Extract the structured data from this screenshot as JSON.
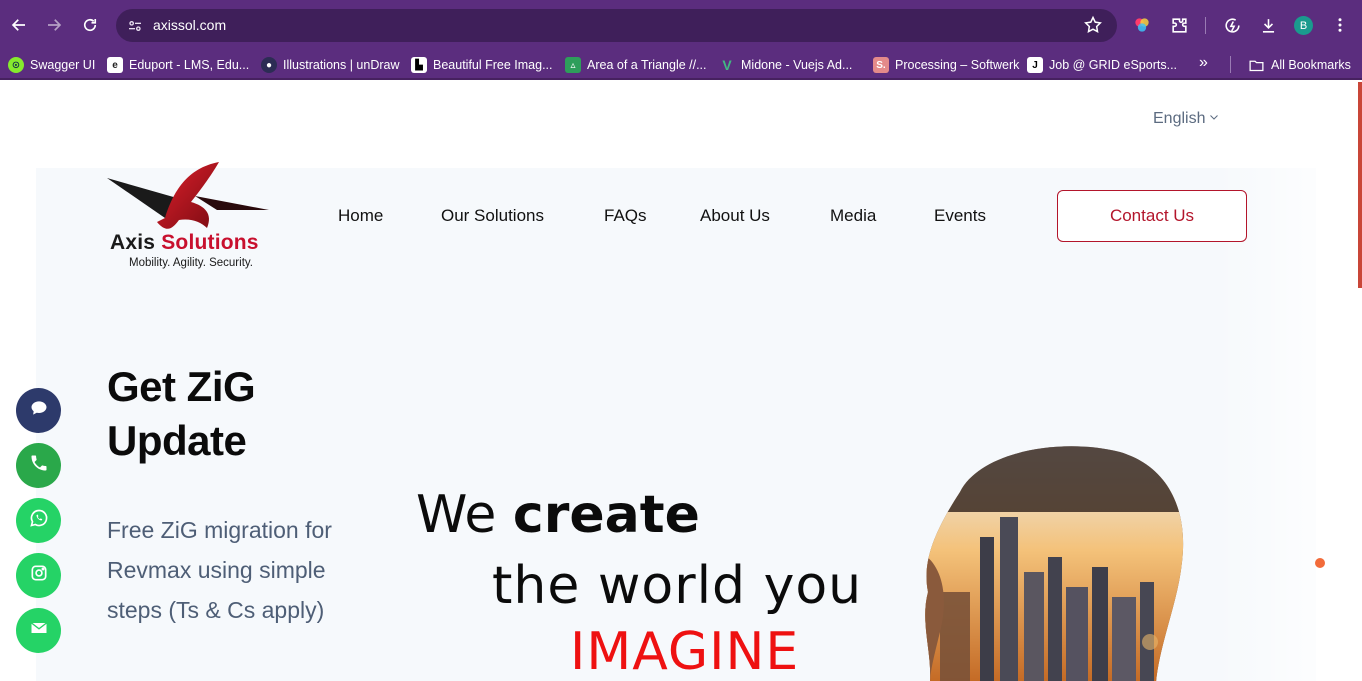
{
  "browser": {
    "url": "axissol.com",
    "profile_initial": "B",
    "bookmarks": [
      {
        "label": "Swagger UI",
        "icon": "swagger-icon",
        "color": "#85ea2d"
      },
      {
        "label": "Eduport - LMS, Edu...",
        "icon": "eduport-icon",
        "color": "#ffffff"
      },
      {
        "label": "Illustrations | unDraw",
        "icon": "undraw-icon",
        "color": "#6c63ff"
      },
      {
        "label": "Beautiful Free Imag...",
        "icon": "unsplash-icon",
        "color": "#000000"
      },
      {
        "label": "Area of a Triangle //...",
        "icon": "triangle-icon",
        "color": "#2e9e5b"
      },
      {
        "label": "Midone - Vuejs Ad...",
        "icon": "vue-icon",
        "color": "#41b883"
      },
      {
        "label": "Processing – Softwerk",
        "icon": "processing-icon",
        "color": "#e48a8a"
      },
      {
        "label": "Job @ GRID eSports...",
        "icon": "grid-icon",
        "color": "#ffffff"
      }
    ],
    "all_bookmarks_label": "All Bookmarks"
  },
  "site": {
    "language": "English",
    "logo": {
      "word_main": "Axis",
      "word_accent": "Solutions",
      "tagline": "Mobility. Agility. Security."
    },
    "nav": [
      "Home",
      "Our Solutions",
      "FAQs",
      "About Us",
      "Media",
      "Events"
    ],
    "contact_label": "Contact Us",
    "hero": {
      "headline_line1": "Get ZiG",
      "headline_line2": "Update",
      "subtext": "Free ZiG migration for Revmax using simple steps (Ts & Cs apply)",
      "slogan_we": "We",
      "slogan_create": "create",
      "slogan_line2": "the world you",
      "slogan_line3": "IMAGINE"
    },
    "floating_actions": [
      {
        "name": "chat",
        "color": "#2d3a6b"
      },
      {
        "name": "phone",
        "color": "#2aa84a"
      },
      {
        "name": "whatsapp",
        "color": "#25d366"
      },
      {
        "name": "instagram",
        "color": "#25d366"
      },
      {
        "name": "email",
        "color": "#25d366"
      }
    ]
  }
}
